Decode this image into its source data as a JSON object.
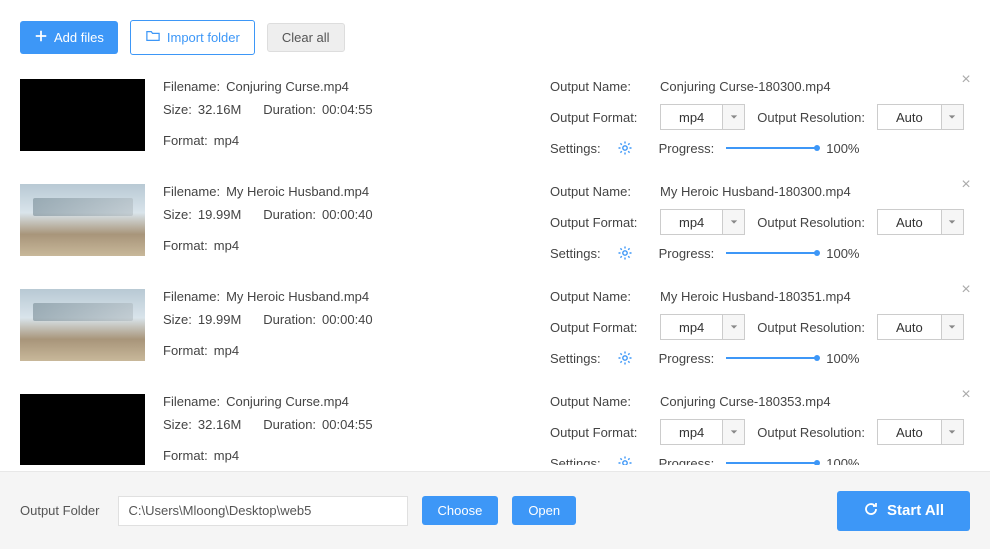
{
  "toolbar": {
    "add_files": "Add files",
    "import_folder": "Import folder",
    "clear_all": "Clear all"
  },
  "labels": {
    "filename": "Filename:",
    "size": "Size:",
    "duration": "Duration:",
    "format": "Format:",
    "output_name": "Output Name:",
    "output_format": "Output Format:",
    "output_resolution": "Output Resolution:",
    "settings": "Settings:",
    "progress": "Progress:"
  },
  "items": [
    {
      "thumb": "black",
      "filename": "Conjuring Curse.mp4",
      "size": "32.16M",
      "duration": "00:04:55",
      "format": "mp4",
      "output_name": "Conjuring Curse-180300.mp4",
      "output_format": "mp4",
      "output_resolution": "Auto",
      "progress": "100%"
    },
    {
      "thumb": "img",
      "filename": "My Heroic Husband.mp4",
      "size": "19.99M",
      "duration": "00:00:40",
      "format": "mp4",
      "output_name": "My Heroic Husband-180300.mp4",
      "output_format": "mp4",
      "output_resolution": "Auto",
      "progress": "100%"
    },
    {
      "thumb": "img",
      "filename": "My Heroic Husband.mp4",
      "size": "19.99M",
      "duration": "00:00:40",
      "format": "mp4",
      "output_name": "My Heroic Husband-180351.mp4",
      "output_format": "mp4",
      "output_resolution": "Auto",
      "progress": "100%"
    },
    {
      "thumb": "black",
      "filename": "Conjuring Curse.mp4",
      "size": "32.16M",
      "duration": "00:04:55",
      "format": "mp4",
      "output_name": "Conjuring Curse-180353.mp4",
      "output_format": "mp4",
      "output_resolution": "Auto",
      "progress": "100%"
    }
  ],
  "footer": {
    "output_folder_label": "Output Folder",
    "path": "C:\\Users\\Mloong\\Desktop\\web5",
    "choose": "Choose",
    "open": "Open",
    "start_all": "Start All"
  }
}
